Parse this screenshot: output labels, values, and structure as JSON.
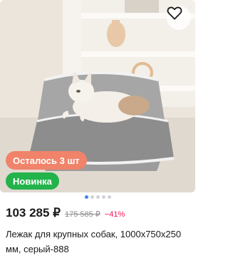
{
  "product": {
    "badges": {
      "stock": "Осталось 3 шт",
      "new": "Новинка"
    },
    "price": {
      "current": "103 285 ₽",
      "old": "175 585 ₽",
      "discount": "−41%"
    },
    "title": "Лежак для крупных собак, 1000х750х250 мм, серый-888"
  },
  "gallery": {
    "dots_total": 5,
    "active_index": 0
  },
  "icons": {
    "favorite": "heart-outline-icon"
  },
  "colors": {
    "accent_dot": "#3d82ff",
    "discount": "#f91155",
    "badge_stock": "#f0836a",
    "badge_new": "#22b34b"
  }
}
